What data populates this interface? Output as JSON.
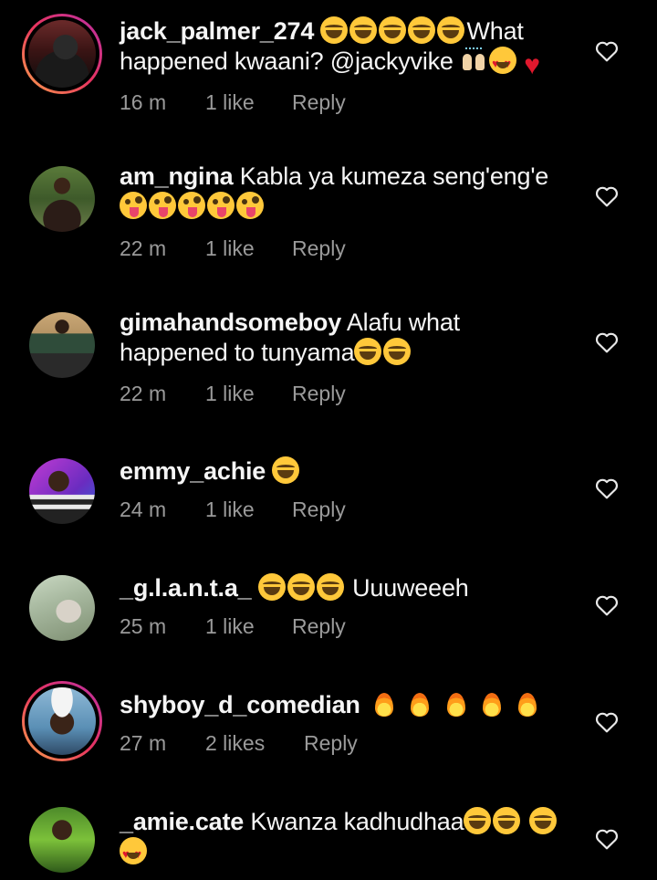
{
  "comments": [
    {
      "username": "jack_palmer_274",
      "text": "😂😂😂😂😂What happened kwaani? @jackyvike 🙌😍❤️",
      "time": "16 m",
      "likes": "1 like",
      "reply": "Reply",
      "avatar_story_ring": true
    },
    {
      "username": "am_ngina",
      "text": "Kabla ya kumeza seng'eng'e🤪🤪🤪🤪🤪",
      "time": "22 m",
      "likes": "1 like",
      "reply": "Reply",
      "avatar_story_ring": false
    },
    {
      "username": "gimahandsomeboy",
      "text": "Alafu what happened to tunyama😂😂",
      "time": "22 m",
      "likes": "1 like",
      "reply": "Reply",
      "avatar_story_ring": false
    },
    {
      "username": "emmy_achie",
      "text": "😂",
      "time": "24 m",
      "likes": "1 like",
      "reply": "Reply",
      "avatar_story_ring": false
    },
    {
      "username": "_g.l.a.n.t.a_",
      "text": "😂😂😂 Uuuweeeh",
      "time": "25 m",
      "likes": "1 like",
      "reply": "Reply",
      "avatar_story_ring": false
    },
    {
      "username": "shyboy_d_comedian",
      "text": "🔥🔥🔥🔥🔥",
      "time": "27 m",
      "likes": "2 likes",
      "reply": "Reply",
      "avatar_story_ring": true
    },
    {
      "username": "_amie.cate",
      "text": "Kwanza kadhudhaa😂😂😂😍",
      "time": "",
      "likes": "",
      "reply": "",
      "avatar_story_ring": false
    }
  ],
  "colors": {
    "background": "#000000",
    "text": "#f5f5f5",
    "meta": "#9a9a9a",
    "story_ring": [
      "#f9a24b",
      "#e8345f",
      "#b92fa6"
    ]
  },
  "icons": {
    "like": "heart-outline-icon"
  }
}
